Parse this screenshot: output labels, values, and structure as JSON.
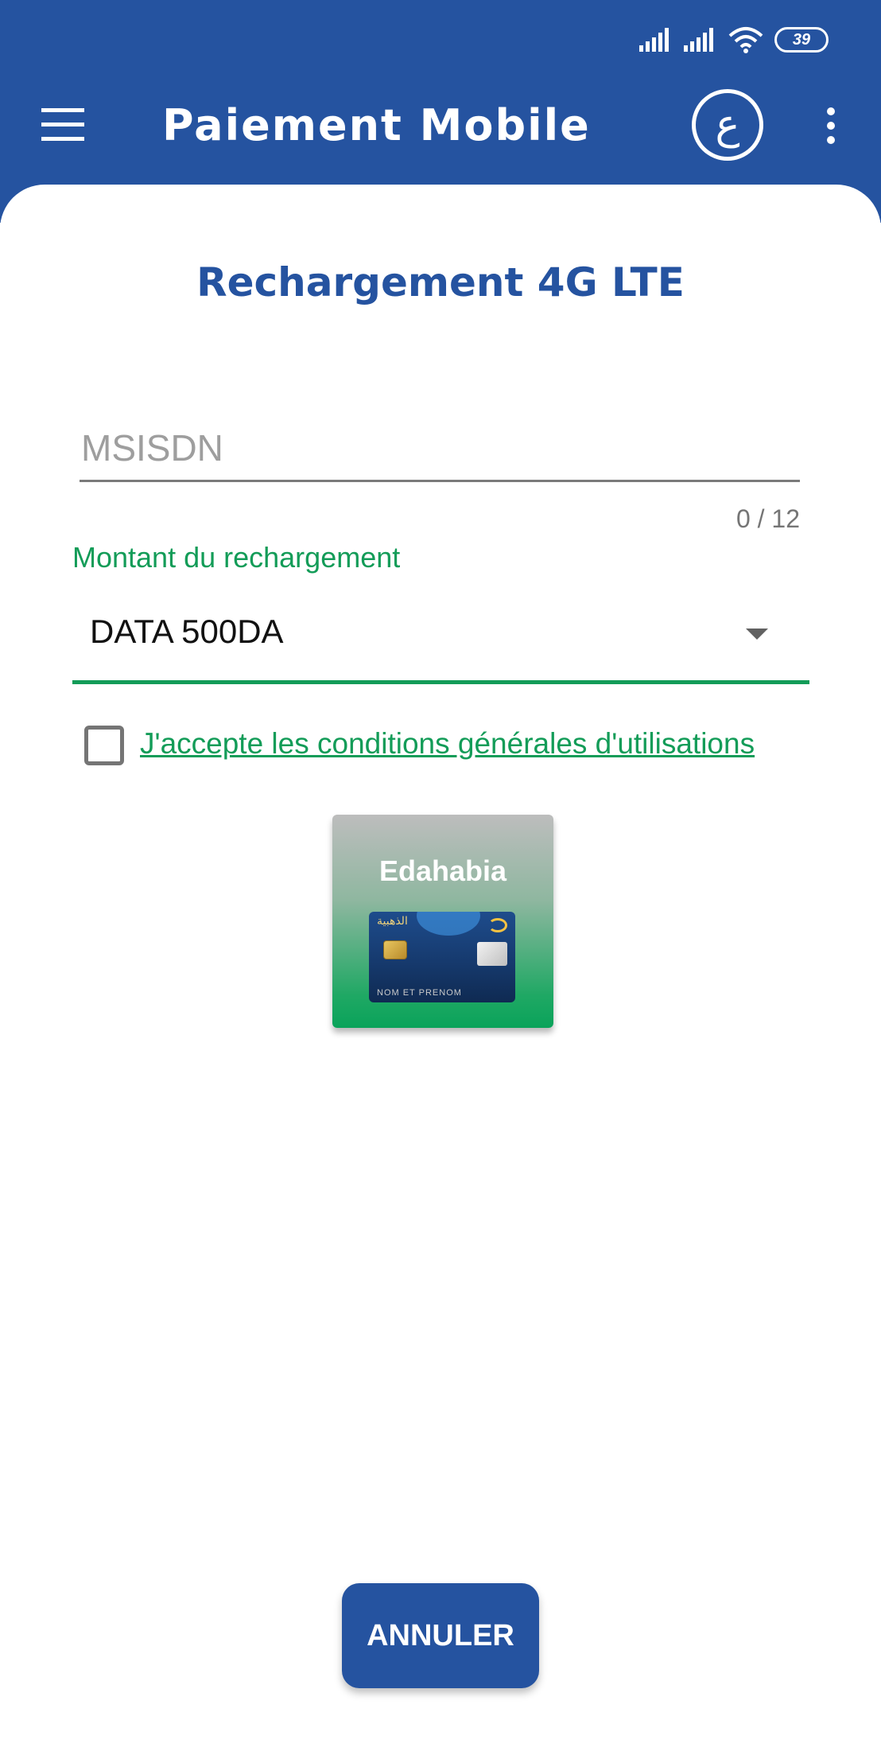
{
  "status_bar": {
    "battery_level": "39",
    "icons": [
      "signal-bars-icon",
      "signal-bars-icon",
      "wifi-icon",
      "battery-icon"
    ]
  },
  "app_bar": {
    "title": "Paiement Mobile",
    "language_button_label": "ع",
    "icons": [
      "hamburger-menu-icon",
      "more-vertical-icon"
    ]
  },
  "form": {
    "title": "Rechargement 4G LTE",
    "msisdn": {
      "placeholder": "MSISDN",
      "value": "",
      "counter": "0 / 12"
    },
    "amount": {
      "label": "Montant du rechargement",
      "selected": "DATA 500DA"
    },
    "terms": {
      "checked": false,
      "label": "J'accepte les conditions générales d'utilisations"
    }
  },
  "payment_method": {
    "title": "Edahabia",
    "card_text": "الذهبية",
    "card_holder": "NOM ET PRENOM"
  },
  "actions": {
    "cancel_label": "ANNULER"
  },
  "colors": {
    "primary": "#2553a0",
    "accent": "#139c58",
    "background": "#ffffff"
  }
}
